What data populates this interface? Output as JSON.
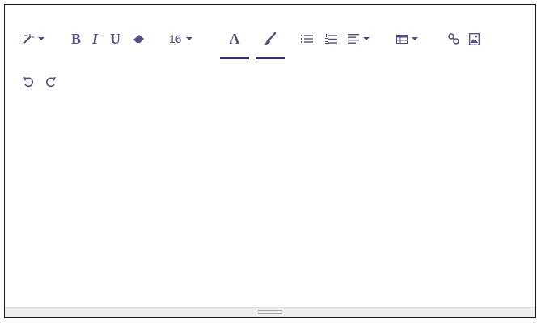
{
  "toolbar": {
    "font_size": "16",
    "bold_label": "B",
    "italic_label": "I",
    "underline_label": "U",
    "text_color_label": "A",
    "accent_color": "#5a4a86",
    "indicator_color": "#3b2b6b",
    "icons": {
      "style": "magic-wand-icon",
      "eraser": "eraser-icon",
      "highlight": "paint-brush-icon",
      "unordered_list": "bullet-list-icon",
      "ordered_list": "numbered-list-icon",
      "align": "align-left-icon",
      "table": "table-icon",
      "link": "link-icon",
      "image": "image-icon",
      "undo": "undo-icon",
      "redo": "redo-icon"
    }
  },
  "editor": {
    "content": ""
  }
}
